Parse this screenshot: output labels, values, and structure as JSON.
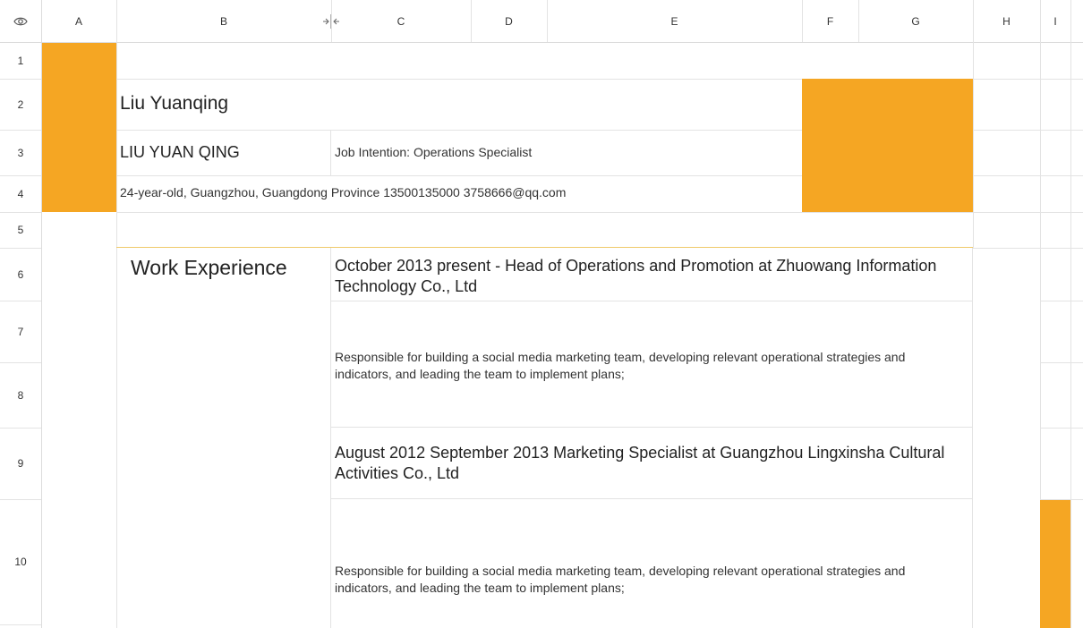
{
  "columns": [
    "A",
    "B",
    "C",
    "D",
    "E",
    "F",
    "G",
    "H",
    "I"
  ],
  "rows": [
    "1",
    "2",
    "3",
    "4",
    "5",
    "6",
    "7",
    "8",
    "9",
    "10"
  ],
  "icons": {
    "corner": "eye-icon",
    "resize": "column-resize-icon"
  },
  "colors": {
    "accent": "#f5a623",
    "divider": "#f0c96a",
    "grid": "#e3e3e3"
  },
  "resume": {
    "name": "Liu Yuanqing",
    "name_pinyin": "LIU YUAN QING",
    "job_intention": "Job Intention: Operations Specialist",
    "info": "24-year-old, Guangzhou, Guangdong Province 13500135000 3758666@qq.com",
    "section_title": "Work Experience",
    "jobs": [
      {
        "title": "October 2013 present - Head of Operations and Promotion at Zhuowang Information Technology Co., Ltd",
        "description": "Responsible for building a social media marketing team, developing relevant operational strategies and indicators, and leading the team to implement plans;"
      },
      {
        "title": "August 2012 September 2013 Marketing Specialist at Guangzhou Lingxinsha Cultural Activities Co., Ltd",
        "description": "Responsible for building a social media marketing team, developing relevant operational strategies and indicators, and leading the team to implement plans;"
      }
    ]
  }
}
